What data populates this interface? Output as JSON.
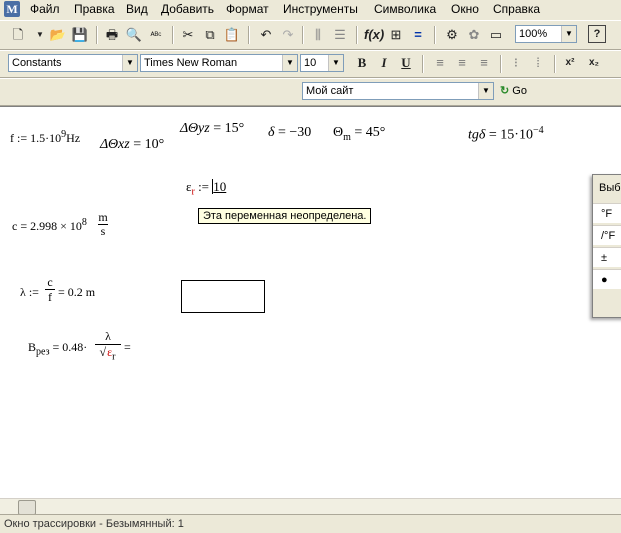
{
  "menu": [
    "Файл",
    "Правка",
    "Вид",
    "Добавить",
    "Формат",
    "Инструменты",
    "Символика",
    "Окно",
    "Справка"
  ],
  "toolbar": {
    "zoom": "100%"
  },
  "format_bar": {
    "style": "Constants",
    "font": "Times New Roman",
    "size": "10",
    "bold": "B",
    "italic": "I",
    "underline": "U",
    "superscript": "x²",
    "subscript": "x₂"
  },
  "resource_bar": {
    "site": "Мой сайт",
    "go": "Go"
  },
  "worksheet": {
    "f_def": {
      "name": "f",
      "assign": ":=",
      "value": "1.5·10",
      "exp": "9",
      "unit": "Hz"
    },
    "dtheta_xz": {
      "lhs": "ΔΘxz",
      "rhs": "= 10°"
    },
    "dtheta_yz": {
      "lhs": "ΔΘyz",
      "rhs": "= 15°"
    },
    "delta": {
      "lhs": "δ",
      "rhs": "= −30"
    },
    "theta_m": {
      "lhs": "Θ",
      "sub": "m",
      "rhs": "= 45°"
    },
    "tg_delta": {
      "lhs": "tgδ",
      "rhs": "= 15·10",
      "exp": "−4"
    },
    "eps_r": {
      "lhs": "ε",
      "sub": "r",
      "assign": ":=",
      "value": "10"
    },
    "tooltip": "Эта переменная неопределена.",
    "c_def": {
      "name": "c",
      "rhs": "= 2.998 × 10",
      "exp": "8",
      "unit_num": "m",
      "unit_den": "s"
    },
    "lambda_def": {
      "name": "λ",
      "assign": ":=",
      "num": "c",
      "den": "f",
      "rhs": "= 0.2 m"
    },
    "b_def": {
      "name": "B",
      "sub": "рез",
      "assign": "= 0.48·",
      "num": "λ",
      "den": "ε",
      "den_sub": "r",
      "tail": "="
    }
  },
  "side_panel": {
    "title": "Выб",
    "rows": [
      "°F",
      "/°F",
      "±",
      "●"
    ]
  },
  "status": "Окно трассировки - Безымянный: 1"
}
